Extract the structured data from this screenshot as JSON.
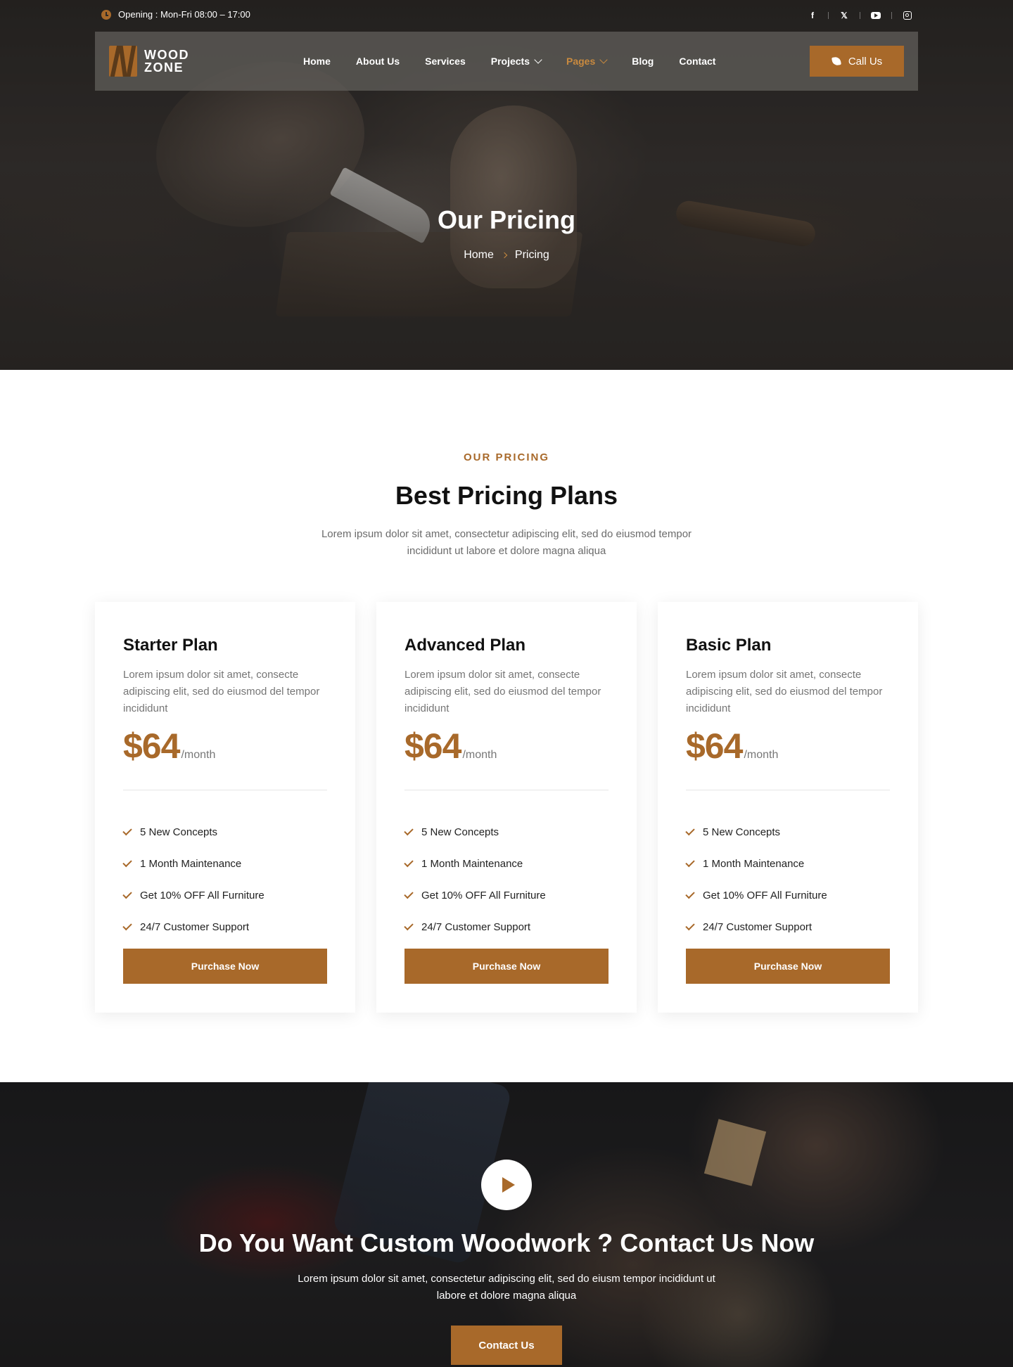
{
  "topbar": {
    "opening_text": "Opening : Mon-Fri 08:00 – 17:00",
    "socials": [
      {
        "icon": "facebook-icon",
        "glyph": "f"
      },
      {
        "icon": "x-twitter-icon",
        "glyph": "𝕏"
      },
      {
        "icon": "youtube-icon",
        "glyph": ""
      },
      {
        "icon": "instagram-icon",
        "glyph": ""
      }
    ]
  },
  "logo": {
    "line1": "WOOD",
    "line2": "ZONE"
  },
  "nav": {
    "items": [
      {
        "label": "Home",
        "dropdown": false,
        "active": false
      },
      {
        "label": "About Us",
        "dropdown": false,
        "active": false
      },
      {
        "label": "Services",
        "dropdown": false,
        "active": false
      },
      {
        "label": "Projects",
        "dropdown": true,
        "active": false
      },
      {
        "label": "Pages",
        "dropdown": true,
        "active": true
      },
      {
        "label": "Blog",
        "dropdown": false,
        "active": false
      },
      {
        "label": "Contact",
        "dropdown": false,
        "active": false
      }
    ],
    "call_label": "Call Us"
  },
  "hero": {
    "title": "Our Pricing",
    "breadcrumb_home": "Home",
    "breadcrumb_current": "Pricing"
  },
  "pricing": {
    "label": "OUR PRICING",
    "title": "Best Pricing Plans",
    "description": "Lorem ipsum dolor sit amet, consectetur adipiscing elit, sed do eiusmod tempor incididunt ut labore et dolore magna aliqua",
    "plans": [
      {
        "name": "Starter Plan",
        "description": "Lorem ipsum dolor sit amet, consecte adipiscing elit, sed do eiusmod del tempor incididunt",
        "price": "$64",
        "period": "/month",
        "features": [
          "5 New Concepts",
          "1 Month Maintenance",
          "Get 10% OFF All Furniture",
          "24/7 Customer Support"
        ],
        "button": "Purchase Now"
      },
      {
        "name": "Advanced Plan",
        "description": "Lorem ipsum dolor sit amet, consecte adipiscing elit, sed do eiusmod del tempor incididunt",
        "price": "$64",
        "period": "/month",
        "features": [
          "5 New Concepts",
          "1 Month Maintenance",
          "Get 10% OFF All Furniture",
          "24/7 Customer Support"
        ],
        "button": "Purchase Now"
      },
      {
        "name": "Basic Plan",
        "description": "Lorem ipsum dolor sit amet, consecte adipiscing elit, sed do eiusmod del tempor incididunt",
        "price": "$64",
        "period": "/month",
        "features": [
          "5 New Concepts",
          "1 Month Maintenance",
          "Get 10% OFF All Furniture",
          "24/7 Customer Support"
        ],
        "button": "Purchase Now"
      }
    ]
  },
  "cta": {
    "title": "Do You Want Custom Woodwork ? Contact Us Now",
    "description": "Lorem ipsum dolor sit amet, consectetur adipiscing elit, sed do eiusm tempor incididunt ut labore et dolore magna aliqua",
    "button": "Contact Us"
  },
  "colors": {
    "accent": "#a8692a",
    "nav_active": "#c98a3f"
  }
}
